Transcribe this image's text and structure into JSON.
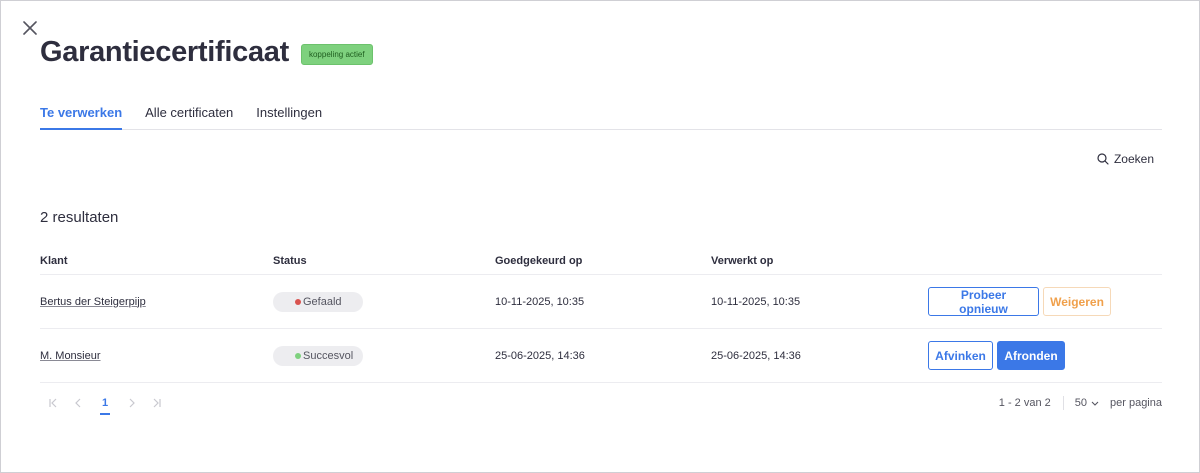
{
  "header": {
    "title": "Garantiecertificaat",
    "badge": "koppeling actief"
  },
  "tabs": [
    {
      "label": "Te verwerken",
      "active": true
    },
    {
      "label": "Alle certificaten",
      "active": false
    },
    {
      "label": "Instellingen",
      "active": false
    }
  ],
  "search": {
    "label": "Zoeken"
  },
  "results_label": "2 resultaten",
  "table": {
    "columns": [
      "Klant",
      "Status",
      "Goedgekeurd op",
      "Verwerkt op"
    ],
    "rows": [
      {
        "client": "Bertus der Steigerpijp",
        "status": "Gefaald",
        "status_color": "#d9534f",
        "approved": "10-11-2025, 10:35",
        "processed": "10-11-2025, 10:35",
        "actions": [
          "Probeer opnieuw",
          "Weigeren"
        ]
      },
      {
        "client": "M. Monsieur",
        "status": "Succesvol",
        "status_color": "#7ed17e",
        "approved": "25-06-2025, 14:36",
        "processed": "25-06-2025, 14:36",
        "actions": [
          "Afvinken",
          "Afronden"
        ]
      }
    ]
  },
  "pagination": {
    "current_page": "1",
    "range": "1 - 2 van 2",
    "per_page": "50",
    "per_page_label": "per pagina"
  },
  "icons": {
    "close": "close-icon",
    "search": "search-icon",
    "first": "first-page-icon",
    "prev": "previous-page-icon",
    "next": "next-page-icon",
    "last": "last-page-icon",
    "dropdown": "chevron-down-icon"
  },
  "colors": {
    "accent": "#3b78e7",
    "warning": "#f0a04b",
    "badge_bg": "#7ed17e"
  }
}
